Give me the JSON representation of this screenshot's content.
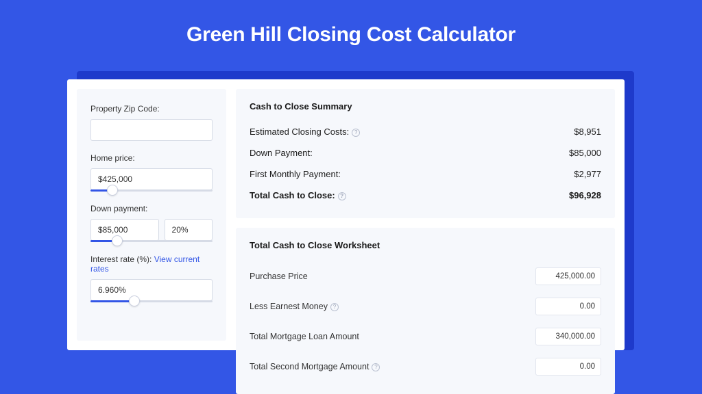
{
  "title": "Green Hill Closing Cost Calculator",
  "left": {
    "zip_label": "Property Zip Code:",
    "zip_value": "",
    "price_label": "Home price:",
    "price_value": "$425,000",
    "price_slider_pct": 18,
    "down_label": "Down payment:",
    "down_value": "$85,000",
    "down_pct_value": "20%",
    "down_slider_pct": 22,
    "rate_label": "Interest rate (%): ",
    "rate_link": "View current rates",
    "rate_value": "6.960%",
    "rate_slider_pct": 36
  },
  "summary": {
    "heading": "Cash to Close Summary",
    "rows": [
      {
        "label": "Estimated Closing Costs:",
        "help": true,
        "value": "$8,951",
        "bold": false
      },
      {
        "label": "Down Payment:",
        "help": false,
        "value": "$85,000",
        "bold": false
      },
      {
        "label": "First Monthly Payment:",
        "help": false,
        "value": "$2,977",
        "bold": false
      },
      {
        "label": "Total Cash to Close:",
        "help": true,
        "value": "$96,928",
        "bold": true
      }
    ]
  },
  "worksheet": {
    "heading": "Total Cash to Close Worksheet",
    "rows": [
      {
        "label": "Purchase Price",
        "help": false,
        "value": "425,000.00"
      },
      {
        "label": "Less Earnest Money",
        "help": true,
        "value": "0.00"
      },
      {
        "label": "Total Mortgage Loan Amount",
        "help": false,
        "value": "340,000.00"
      },
      {
        "label": "Total Second Mortgage Amount",
        "help": true,
        "value": "0.00"
      }
    ]
  }
}
